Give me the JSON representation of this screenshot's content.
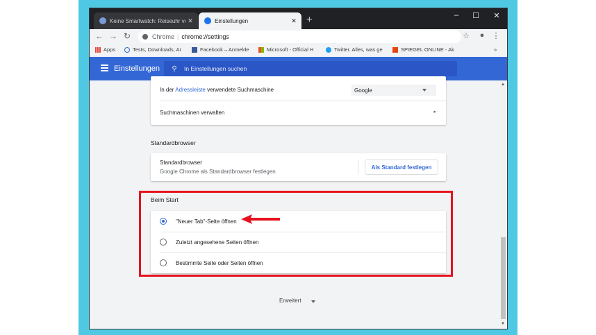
{
  "tabs": [
    {
      "title": "Keine Smartwatch: Reiseuhr von",
      "active": false
    },
    {
      "title": "Einstellungen",
      "active": true
    }
  ],
  "address": {
    "site": "Chrome",
    "url": "chrome://settings"
  },
  "bookmarks": [
    "Apps",
    "Tests, Downloads, Ar",
    "Facebook – Anmelde",
    "Microsoft - Official H",
    "Twitter. Alles, was ge",
    "SPIEGEL ONLINE - Ak"
  ],
  "bookmarks_overflow": "»",
  "header": {
    "title": "Einstellungen",
    "search_placeholder": "In Einstellungen suchen"
  },
  "search_engine": {
    "address_bar_label_prefix": "In der",
    "address_bar_link": "Adressleiste",
    "address_bar_label_suffix": "verwendete Suchmaschine",
    "engine_value": "Google",
    "manage_label": "Suchmaschinen verwalten"
  },
  "default_browser": {
    "section_title": "Standardbrowser",
    "row_title": "Standardbrowser",
    "row_subtitle": "Google Chrome als Standardbrowser festlegen",
    "button_label": "Als Standard festlegen"
  },
  "on_startup": {
    "section_title": "Beim Start",
    "options": [
      {
        "label": "\"Neuer Tab\"-Seite öffnen",
        "selected": true
      },
      {
        "label": "Zuletzt angesehene Seiten öffnen",
        "selected": false
      },
      {
        "label": "Bestimmte Seite oder Seiten öffnen",
        "selected": false
      }
    ]
  },
  "advanced_label": "Erweitert",
  "colors": {
    "accent": "#3367d6",
    "highlight": "#e8121f",
    "frame": "#4fc9e3"
  }
}
